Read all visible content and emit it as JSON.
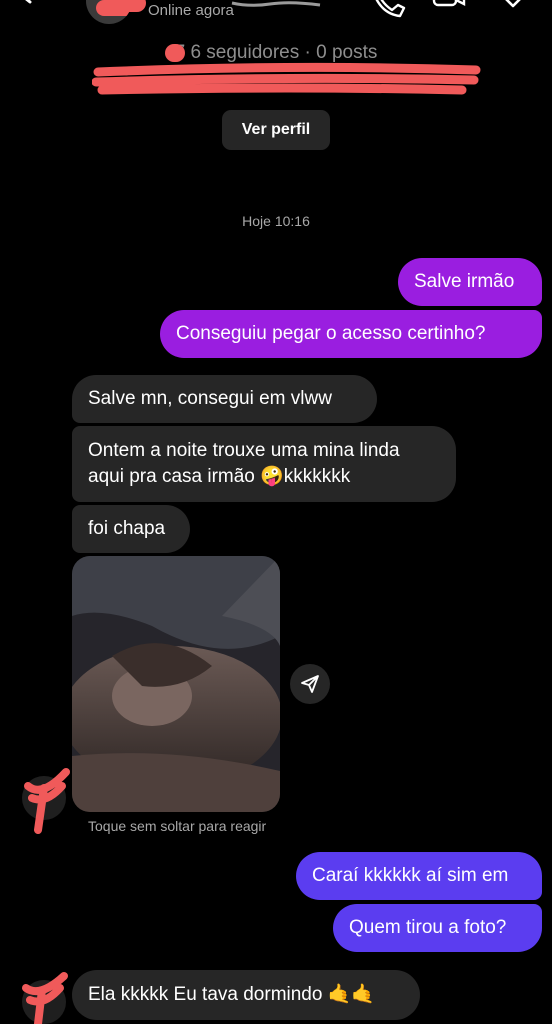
{
  "header": {
    "status": "Online agora",
    "followers": "7 6 seguidores · 0 posts",
    "view_profile": "Ver perfil"
  },
  "conversation": {
    "date": "Hoje 10:16",
    "messages": [
      {
        "from": "me",
        "text": "Salve irmão"
      },
      {
        "from": "me",
        "text": "Conseguiu pegar o acesso certinho?"
      },
      {
        "from": "them",
        "text": "Salve mn, consegui em vlww"
      },
      {
        "from": "them",
        "line1": "Ontem a noite trouxe uma mina linda",
        "line2": "aqui pra casa irmão 🤪kkkkkkk"
      },
      {
        "from": "them",
        "text": "foi chapa"
      },
      {
        "from": "me",
        "text": "Caraí kkkkkk aí sim em"
      },
      {
        "from": "me",
        "text": "Quem tirou a foto?"
      },
      {
        "from": "them",
        "text": "Ela kkkkk Eu tava dormindo 🤙🤙"
      }
    ],
    "photo_hint": "Toque sem soltar para reagir"
  },
  "colors": {
    "background": "#000000",
    "sent_bubble": "#9a1ee0",
    "sent_bubble_late": "#5b3df0",
    "received_bubble": "#262626",
    "redaction": "#f05a5a"
  },
  "icons": [
    "back-arrow-icon",
    "phone-icon",
    "video-icon",
    "heart-icon",
    "share-icon"
  ]
}
